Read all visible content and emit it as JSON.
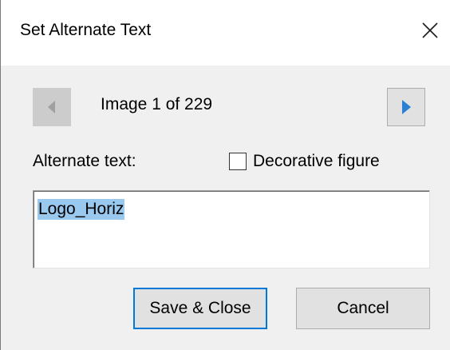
{
  "dialog": {
    "title": "Set Alternate Text",
    "close_icon": "close-icon"
  },
  "navigation": {
    "prev_icon": "triangle-left-icon",
    "next_icon": "triangle-right-icon",
    "counter": "Image 1 of 229",
    "prev_enabled": false,
    "next_enabled": true
  },
  "alt_text": {
    "label": "Alternate text:",
    "value": "Logo_Horiz",
    "selected": true
  },
  "decorative": {
    "label": "Decorative figure",
    "checked": false
  },
  "buttons": {
    "save_accel": "S",
    "save_rest": "ave & Close",
    "cancel_accel": "C",
    "cancel_rest": "ancel"
  },
  "colors": {
    "accent": "#0078d7",
    "selection": "#99c9ef",
    "next_arrow": "#2b7fd4",
    "prev_arrow_disabled": "#a0a0a0"
  }
}
